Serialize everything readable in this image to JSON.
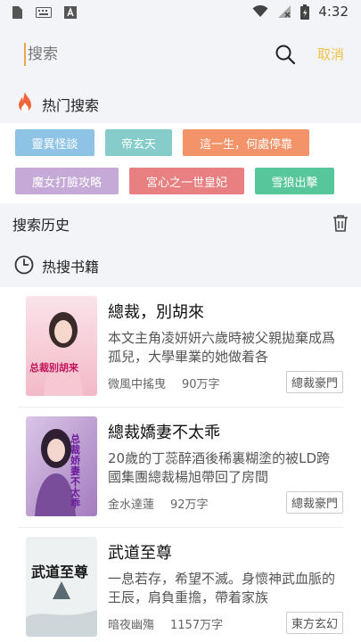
{
  "status": {
    "time": "4:32"
  },
  "search": {
    "placeholder": "搜索",
    "cancel_label": "取消"
  },
  "hot_search": {
    "title": "热门搜索",
    "tags": [
      {
        "label": "靈異怪談",
        "color": "#8fc3e6"
      },
      {
        "label": "帝玄天",
        "color": "#86cccb"
      },
      {
        "label": "這一生，何處停靠",
        "color": "#f3936a"
      },
      {
        "label": "魔女打臉攻略",
        "color": "#c5a9d6"
      },
      {
        "label": "宮心之一世皇妃",
        "color": "#e87f80"
      },
      {
        "label": "雪狼出擊",
        "color": "#57c69b"
      }
    ]
  },
  "history": {
    "title": "搜索历史"
  },
  "hot_books": {
    "title": "热搜书籍",
    "items": [
      {
        "title": "總裁，別胡來",
        "desc": "本文主角凌妍妍六歲時被父親拋棄成爲孤兒，大學畢業的她做着各",
        "author": "微風中搖曳",
        "words": "90万字",
        "genre": "總裁豪門",
        "cover_text": "总裁别胡来"
      },
      {
        "title": "總裁嬌妻不太乖",
        "desc": "20歲的丁蕊醉酒後稀裏糊塗的被LD跨國集團總裁楊旭帶回了房間",
        "author": "金水達蓮",
        "words": "92万字",
        "genre": "總裁豪門",
        "cover_text": "总裁娇妻不太乖"
      },
      {
        "title": "武道至尊",
        "desc": "一息若存，希望不滅。身懷神武血脈的王辰，肩負重擔，帶着家族",
        "author": "暗夜幽殤",
        "words": "1157万字",
        "genre": "東方玄幻",
        "cover_text": "武道至尊"
      }
    ]
  }
}
